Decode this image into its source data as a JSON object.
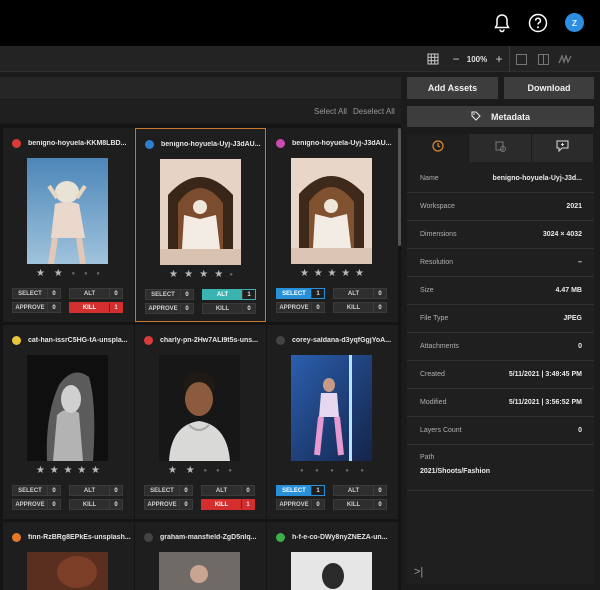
{
  "header": {
    "bell_icon": "bell-icon",
    "help_icon": "help-circle-icon",
    "avatar_initial": "z"
  },
  "toolbar": {
    "zoom_value": "100%",
    "zoom_out": "−",
    "zoom_in": "+"
  },
  "selection": {
    "select_all": "Select All",
    "deselect_all": "Deselect All"
  },
  "actions": {
    "add_assets": "Add Assets",
    "download": "Download",
    "metadata": "Metadata"
  },
  "assets": [
    {
      "name": "benigno-hoyuela-KKM8LBD...",
      "label_color": "#d93b3b",
      "stars": 2,
      "select": "SELECT",
      "select_count": "0",
      "alt": "ALT",
      "alt_count": "0",
      "approve": "APPROVE",
      "approve_count": "0",
      "kill": "KILL",
      "kill_count": "1",
      "state": "kill"
    },
    {
      "name": "benigno-hoyuela-Uyj-J3dAU...",
      "label_color": "#2d7fd0",
      "stars": 4,
      "select": "SELECT",
      "select_count": "0",
      "alt": "ALT",
      "alt_count": "1",
      "approve": "APPROVE",
      "approve_count": "0",
      "kill": "KILL",
      "kill_count": "0",
      "state": "alt"
    },
    {
      "name": "benigno-hoyuela-Uyj-J3dAU...",
      "label_color": "#c94bb0",
      "stars": 5,
      "select": "SELECT",
      "select_count": "1",
      "alt": "ALT",
      "alt_count": "0",
      "approve": "APPROVE",
      "approve_count": "0",
      "kill": "KILL",
      "kill_count": "0",
      "state": "select"
    },
    {
      "name": "cat-han-issrC5HG-tA-unspla...",
      "label_color": "#e8c83a",
      "stars": 5,
      "select": "SELECT",
      "select_count": "0",
      "alt": "ALT",
      "alt_count": "0",
      "approve": "APPROVE",
      "approve_count": "0",
      "kill": "KILL",
      "kill_count": "0",
      "state": "none"
    },
    {
      "name": "charly-pn-2Hw7ALI9t5s-uns...",
      "label_color": "#d93b3b",
      "stars": 2,
      "select": "SELECT",
      "select_count": "0",
      "alt": "ALT",
      "alt_count": "0",
      "approve": "APPROVE",
      "approve_count": "0",
      "kill": "KILL",
      "kill_count": "1",
      "state": "kill"
    },
    {
      "name": "corey-saldana-d3yqfGgjYoA...",
      "label_color": "#444444",
      "stars": 0,
      "select": "SELECT",
      "select_count": "1",
      "alt": "ALT",
      "alt_count": "0",
      "approve": "APPROVE",
      "approve_count": "0",
      "kill": "KILL",
      "kill_count": "0",
      "state": "select"
    },
    {
      "name": "finn-RzBRg8EPkEs-unsplash...",
      "label_color": "#e3792b",
      "stars": 0
    },
    {
      "name": "graham-mansfield-ZgD5nlq...",
      "label_color": "#444444",
      "stars": 0
    },
    {
      "name": "h-f-e-co-DWy8nyZNEZA-un...",
      "label_color": "#3fae4a",
      "stars": 0
    }
  ],
  "metadata": {
    "rows": [
      {
        "key": "Name",
        "value": "benigno-hoyuela-Uyj-J3d..."
      },
      {
        "key": "Workspace",
        "value": "2021"
      },
      {
        "key": "Dimensions",
        "value": "3024 × 4032"
      },
      {
        "key": "Resolution",
        "value": "–"
      },
      {
        "key": "Size",
        "value": "4.47 MB"
      },
      {
        "key": "File Type",
        "value": "JPEG"
      },
      {
        "key": "Attachments",
        "value": "0"
      },
      {
        "key": "Created",
        "value": "5/11/2021 | 3:49:45 PM"
      },
      {
        "key": "Modified",
        "value": "5/11/2021 | 3:56:52 PM"
      },
      {
        "key": "Layers Count",
        "value": "0"
      }
    ],
    "path_key": "Path",
    "path_value": "2021/Shoots/Fashion"
  }
}
